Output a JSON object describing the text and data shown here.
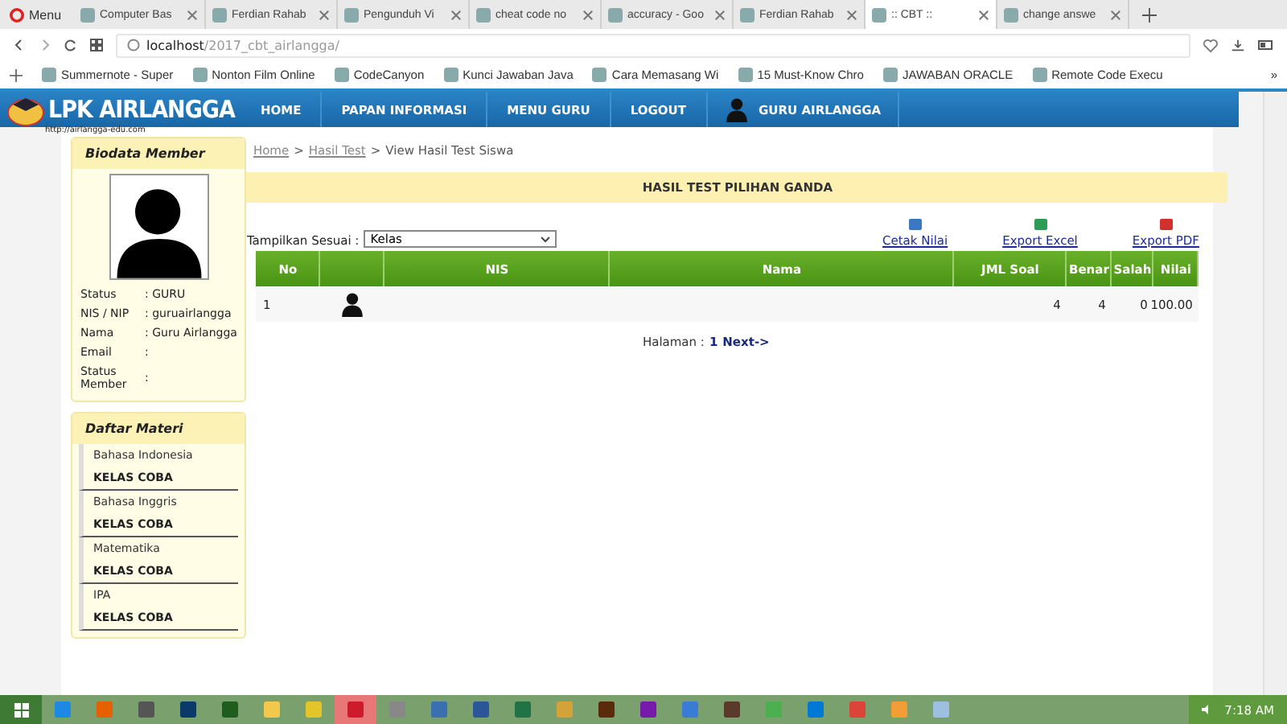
{
  "browser": {
    "menu": "Menu",
    "tabs": [
      {
        "title": "Computer Bas",
        "selected": false
      },
      {
        "title": "Ferdian Rahab",
        "selected": false
      },
      {
        "title": "Pengunduh Vi",
        "selected": false
      },
      {
        "title": "cheat code no",
        "selected": false
      },
      {
        "title": "accuracy - Goo",
        "selected": false
      },
      {
        "title": "Ferdian Rahab",
        "selected": false
      },
      {
        "title": ":: CBT ::",
        "selected": true
      },
      {
        "title": "change answe",
        "selected": false
      }
    ],
    "url_host": "localhost",
    "url_path": "/2017_cbt_airlangga/",
    "bookmarks": [
      "Summernote - Super",
      "Nonton Film Online",
      "CodeCanyon",
      "Kunci Jawaban Java",
      "Cara Memasang Wi",
      "15 Must-Know Chro",
      "JAWABAN ORACLE",
      "Remote Code Execu"
    ],
    "bookmarks_more": "»"
  },
  "site": {
    "logo": "LPK AIRLANGGA",
    "logo_url": "http://airlangga-edu.com",
    "nav": [
      "HOME",
      "PAPAN INFORMASI",
      "MENU GURU",
      "LOGOUT"
    ],
    "user": "GURU AIRLANGGA"
  },
  "biodata": {
    "title": "Biodata Member",
    "fields": [
      {
        "label": "Status",
        "value": ": GURU"
      },
      {
        "label": "NIS / NIP",
        "value": ": guruairlangga"
      },
      {
        "label": "Nama",
        "value": ": Guru Airlangga"
      },
      {
        "label": "Email",
        "value": ":"
      },
      {
        "label": "Status Member",
        "value": ":"
      }
    ]
  },
  "materi": {
    "title": "Daftar Materi",
    "items": [
      {
        "name": "Bahasa Indonesia",
        "kelas": "KELAS COBA"
      },
      {
        "name": "Bahasa Inggris",
        "kelas": "KELAS COBA"
      },
      {
        "name": "Matematika",
        "kelas": "KELAS COBA"
      },
      {
        "name": "IPA",
        "kelas": "KELAS COBA"
      }
    ]
  },
  "breadcrumb": {
    "links": [
      "Home",
      "Hasil Test"
    ],
    "separator": ">",
    "current": "View Hasil Test Siswa"
  },
  "panel_title": "HASIL TEST PILIHAN GANDA",
  "filter": {
    "label": "Tampilkan Sesuai :",
    "value": "Kelas"
  },
  "actions": [
    {
      "kind": "print",
      "label": "Cetak Nilai"
    },
    {
      "kind": "excel",
      "label": "Export Excel"
    },
    {
      "kind": "pdf",
      "label": "Export PDF"
    }
  ],
  "table": {
    "columns": [
      "No",
      "",
      "NIS",
      "Nama",
      "JML Soal",
      "Benar",
      "Salah",
      "Nilai"
    ],
    "rows": [
      {
        "no": "1",
        "jml": "4",
        "benar": "4",
        "salah": "0",
        "nilai": "100.00"
      }
    ]
  },
  "pager": {
    "label": "Halaman :",
    "page": "1",
    "next": "Next->"
  },
  "taskbar": {
    "apps": [
      {
        "selected": false
      },
      {
        "selected": false
      },
      {
        "selected": false
      },
      {
        "selected": false
      },
      {
        "selected": false
      },
      {
        "selected": false
      },
      {
        "selected": false
      },
      {
        "selected": true
      },
      {
        "selected": false
      },
      {
        "selected": false
      },
      {
        "selected": false
      },
      {
        "selected": false
      },
      {
        "selected": false
      },
      {
        "selected": false
      },
      {
        "selected": false
      },
      {
        "selected": false
      },
      {
        "selected": false
      },
      {
        "selected": false
      },
      {
        "selected": false
      },
      {
        "selected": false
      },
      {
        "selected": false
      },
      {
        "selected": false
      }
    ],
    "time": "7:18 AM"
  }
}
